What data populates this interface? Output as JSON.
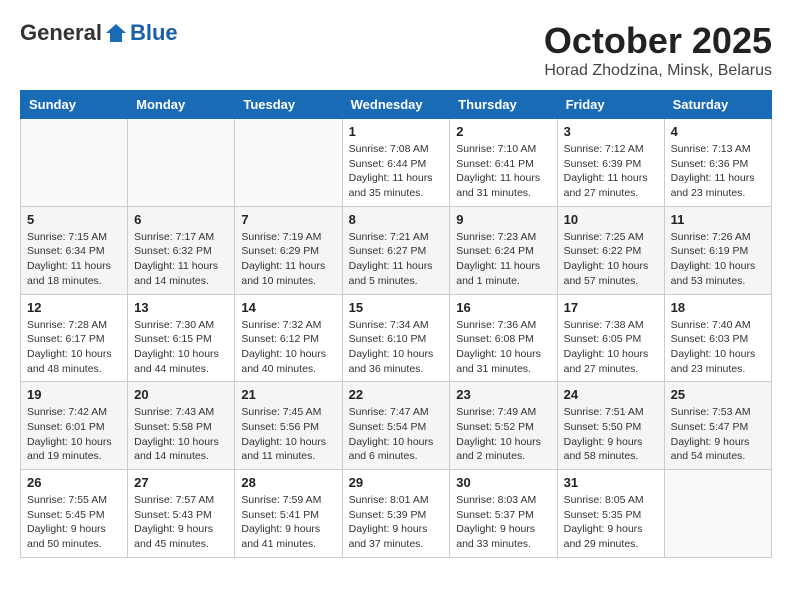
{
  "header": {
    "logo_general": "General",
    "logo_blue": "Blue",
    "month": "October 2025",
    "location": "Horad Zhodzina, Minsk, Belarus"
  },
  "weekdays": [
    "Sunday",
    "Monday",
    "Tuesday",
    "Wednesday",
    "Thursday",
    "Friday",
    "Saturday"
  ],
  "weeks": [
    [
      {
        "day": "",
        "sunrise": "",
        "sunset": "",
        "daylight": ""
      },
      {
        "day": "",
        "sunrise": "",
        "sunset": "",
        "daylight": ""
      },
      {
        "day": "",
        "sunrise": "",
        "sunset": "",
        "daylight": ""
      },
      {
        "day": "1",
        "sunrise": "Sunrise: 7:08 AM",
        "sunset": "Sunset: 6:44 PM",
        "daylight": "Daylight: 11 hours and 35 minutes."
      },
      {
        "day": "2",
        "sunrise": "Sunrise: 7:10 AM",
        "sunset": "Sunset: 6:41 PM",
        "daylight": "Daylight: 11 hours and 31 minutes."
      },
      {
        "day": "3",
        "sunrise": "Sunrise: 7:12 AM",
        "sunset": "Sunset: 6:39 PM",
        "daylight": "Daylight: 11 hours and 27 minutes."
      },
      {
        "day": "4",
        "sunrise": "Sunrise: 7:13 AM",
        "sunset": "Sunset: 6:36 PM",
        "daylight": "Daylight: 11 hours and 23 minutes."
      }
    ],
    [
      {
        "day": "5",
        "sunrise": "Sunrise: 7:15 AM",
        "sunset": "Sunset: 6:34 PM",
        "daylight": "Daylight: 11 hours and 18 minutes."
      },
      {
        "day": "6",
        "sunrise": "Sunrise: 7:17 AM",
        "sunset": "Sunset: 6:32 PM",
        "daylight": "Daylight: 11 hours and 14 minutes."
      },
      {
        "day": "7",
        "sunrise": "Sunrise: 7:19 AM",
        "sunset": "Sunset: 6:29 PM",
        "daylight": "Daylight: 11 hours and 10 minutes."
      },
      {
        "day": "8",
        "sunrise": "Sunrise: 7:21 AM",
        "sunset": "Sunset: 6:27 PM",
        "daylight": "Daylight: 11 hours and 5 minutes."
      },
      {
        "day": "9",
        "sunrise": "Sunrise: 7:23 AM",
        "sunset": "Sunset: 6:24 PM",
        "daylight": "Daylight: 11 hours and 1 minute."
      },
      {
        "day": "10",
        "sunrise": "Sunrise: 7:25 AM",
        "sunset": "Sunset: 6:22 PM",
        "daylight": "Daylight: 10 hours and 57 minutes."
      },
      {
        "day": "11",
        "sunrise": "Sunrise: 7:26 AM",
        "sunset": "Sunset: 6:19 PM",
        "daylight": "Daylight: 10 hours and 53 minutes."
      }
    ],
    [
      {
        "day": "12",
        "sunrise": "Sunrise: 7:28 AM",
        "sunset": "Sunset: 6:17 PM",
        "daylight": "Daylight: 10 hours and 48 minutes."
      },
      {
        "day": "13",
        "sunrise": "Sunrise: 7:30 AM",
        "sunset": "Sunset: 6:15 PM",
        "daylight": "Daylight: 10 hours and 44 minutes."
      },
      {
        "day": "14",
        "sunrise": "Sunrise: 7:32 AM",
        "sunset": "Sunset: 6:12 PM",
        "daylight": "Daylight: 10 hours and 40 minutes."
      },
      {
        "day": "15",
        "sunrise": "Sunrise: 7:34 AM",
        "sunset": "Sunset: 6:10 PM",
        "daylight": "Daylight: 10 hours and 36 minutes."
      },
      {
        "day": "16",
        "sunrise": "Sunrise: 7:36 AM",
        "sunset": "Sunset: 6:08 PM",
        "daylight": "Daylight: 10 hours and 31 minutes."
      },
      {
        "day": "17",
        "sunrise": "Sunrise: 7:38 AM",
        "sunset": "Sunset: 6:05 PM",
        "daylight": "Daylight: 10 hours and 27 minutes."
      },
      {
        "day": "18",
        "sunrise": "Sunrise: 7:40 AM",
        "sunset": "Sunset: 6:03 PM",
        "daylight": "Daylight: 10 hours and 23 minutes."
      }
    ],
    [
      {
        "day": "19",
        "sunrise": "Sunrise: 7:42 AM",
        "sunset": "Sunset: 6:01 PM",
        "daylight": "Daylight: 10 hours and 19 minutes."
      },
      {
        "day": "20",
        "sunrise": "Sunrise: 7:43 AM",
        "sunset": "Sunset: 5:58 PM",
        "daylight": "Daylight: 10 hours and 14 minutes."
      },
      {
        "day": "21",
        "sunrise": "Sunrise: 7:45 AM",
        "sunset": "Sunset: 5:56 PM",
        "daylight": "Daylight: 10 hours and 11 minutes."
      },
      {
        "day": "22",
        "sunrise": "Sunrise: 7:47 AM",
        "sunset": "Sunset: 5:54 PM",
        "daylight": "Daylight: 10 hours and 6 minutes."
      },
      {
        "day": "23",
        "sunrise": "Sunrise: 7:49 AM",
        "sunset": "Sunset: 5:52 PM",
        "daylight": "Daylight: 10 hours and 2 minutes."
      },
      {
        "day": "24",
        "sunrise": "Sunrise: 7:51 AM",
        "sunset": "Sunset: 5:50 PM",
        "daylight": "Daylight: 9 hours and 58 minutes."
      },
      {
        "day": "25",
        "sunrise": "Sunrise: 7:53 AM",
        "sunset": "Sunset: 5:47 PM",
        "daylight": "Daylight: 9 hours and 54 minutes."
      }
    ],
    [
      {
        "day": "26",
        "sunrise": "Sunrise: 7:55 AM",
        "sunset": "Sunset: 5:45 PM",
        "daylight": "Daylight: 9 hours and 50 minutes."
      },
      {
        "day": "27",
        "sunrise": "Sunrise: 7:57 AM",
        "sunset": "Sunset: 5:43 PM",
        "daylight": "Daylight: 9 hours and 45 minutes."
      },
      {
        "day": "28",
        "sunrise": "Sunrise: 7:59 AM",
        "sunset": "Sunset: 5:41 PM",
        "daylight": "Daylight: 9 hours and 41 minutes."
      },
      {
        "day": "29",
        "sunrise": "Sunrise: 8:01 AM",
        "sunset": "Sunset: 5:39 PM",
        "daylight": "Daylight: 9 hours and 37 minutes."
      },
      {
        "day": "30",
        "sunrise": "Sunrise: 8:03 AM",
        "sunset": "Sunset: 5:37 PM",
        "daylight": "Daylight: 9 hours and 33 minutes."
      },
      {
        "day": "31",
        "sunrise": "Sunrise: 8:05 AM",
        "sunset": "Sunset: 5:35 PM",
        "daylight": "Daylight: 9 hours and 29 minutes."
      },
      {
        "day": "",
        "sunrise": "",
        "sunset": "",
        "daylight": ""
      }
    ]
  ]
}
